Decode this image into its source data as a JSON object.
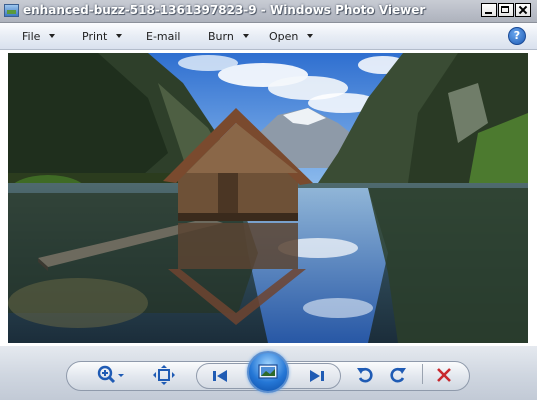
{
  "window": {
    "title": "enhanced-buzz-518-1361397823-9 - Windows Photo Viewer"
  },
  "menu": [
    {
      "label": "File",
      "has_dropdown": true
    },
    {
      "label": "Print",
      "has_dropdown": true
    },
    {
      "label": "E-mail",
      "has_dropdown": false
    },
    {
      "label": "Burn",
      "has_dropdown": true
    },
    {
      "label": "Open",
      "has_dropdown": true
    }
  ],
  "help": {
    "icon": "help-icon",
    "glyph": "?"
  },
  "image": {
    "description_icon": "photo-lake-boathouse"
  },
  "controls": {
    "zoom_icon": "zoom-in-icon",
    "actual_size_icon": "actual-size-icon",
    "previous_icon": "previous-icon",
    "slideshow_icon": "slideshow-icon",
    "next_icon": "next-icon",
    "rotate_ccw_icon": "rotate-counterclockwise-icon",
    "rotate_cw_icon": "rotate-clockwise-icon",
    "delete_icon": "delete-icon"
  },
  "colors": {
    "accent_blue": "#1f5bb4",
    "delete_red": "#c8282d"
  }
}
